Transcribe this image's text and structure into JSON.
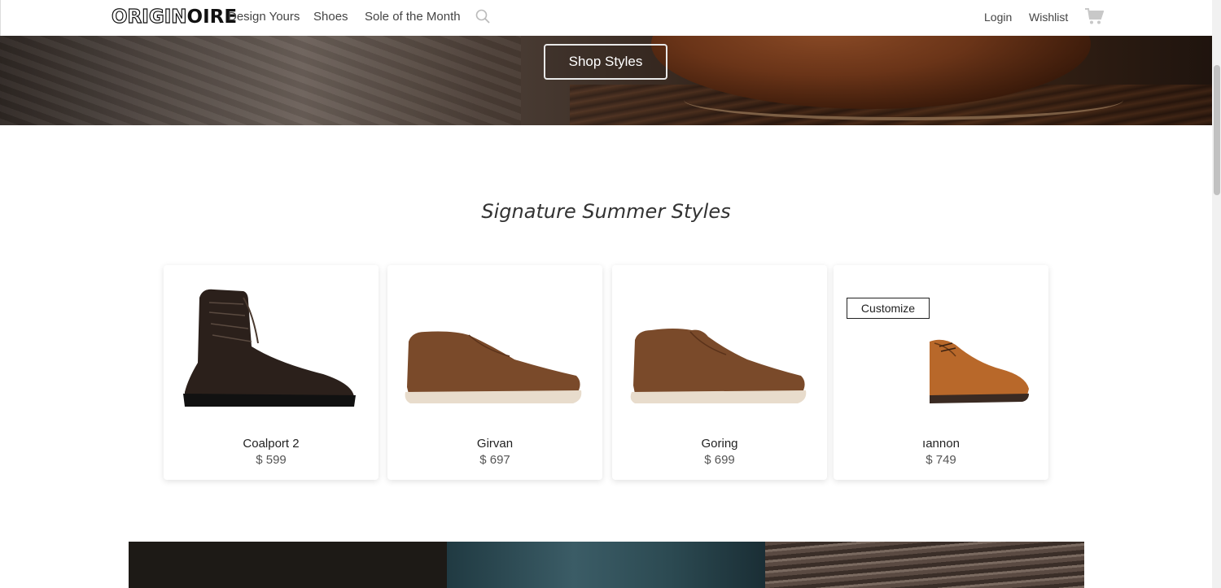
{
  "brand": {
    "logo_part1": "ORIGIN",
    "logo_part2": "OIRE"
  },
  "nav": {
    "links": [
      "Design Yours",
      "Shoes",
      "Sole of the Month"
    ],
    "login": "Login",
    "wishlist": "Wishlist",
    "icons": {
      "search": "search-icon",
      "cart": "cart-icon"
    }
  },
  "hero": {
    "button": "Shop Styles"
  },
  "section": {
    "title": "Signature Summer Styles"
  },
  "products": [
    {
      "name": "Coalport 2",
      "price": "$ 599",
      "color": "#2b201b"
    },
    {
      "name": "Girvan",
      "price": "$ 697",
      "color": "#7a4a2a"
    },
    {
      "name": "Goring",
      "price": "$ 699",
      "color": "#7a4a2a"
    },
    {
      "name": "ıannon",
      "price": "$ 749",
      "color": "#b8682a",
      "customize_label": "Customize"
    }
  ],
  "colors": {
    "accent": "#222222",
    "hero_dark": "#2a1a12"
  }
}
